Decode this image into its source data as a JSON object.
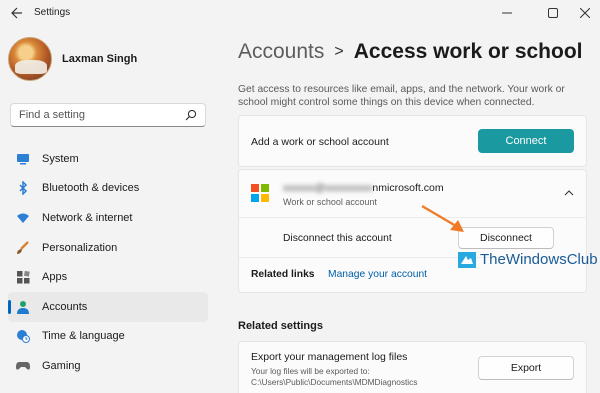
{
  "window": {
    "title": "Settings",
    "controls": [
      "minimize",
      "maximize",
      "close"
    ]
  },
  "profile": {
    "name": "Laxman Singh"
  },
  "search": {
    "placeholder": "Find a setting"
  },
  "nav": {
    "items": [
      {
        "label": "System",
        "icon": "monitor-icon"
      },
      {
        "label": "Bluetooth & devices",
        "icon": "bluetooth-icon"
      },
      {
        "label": "Network & internet",
        "icon": "wifi-icon"
      },
      {
        "label": "Personalization",
        "icon": "brush-icon"
      },
      {
        "label": "Apps",
        "icon": "apps-icon"
      },
      {
        "label": "Accounts",
        "icon": "person-icon",
        "active": true
      },
      {
        "label": "Time & language",
        "icon": "globe-clock-icon"
      },
      {
        "label": "Gaming",
        "icon": "gamepad-icon"
      }
    ]
  },
  "breadcrumb": {
    "parent": "Accounts",
    "separator": ">",
    "current": "Access work or school"
  },
  "description": "Get access to resources like email, apps, and the network. Your work or school might control some things on this device when connected.",
  "add_account": {
    "label": "Add a work or school account",
    "button": "Connect",
    "accent": "#1a9aa0"
  },
  "account": {
    "email_hidden": "xxxxxx@xxxxxxxxx",
    "email_visible": "nmicrosoft.com",
    "type": "Work or school account",
    "disconnect_label": "Disconnect this account",
    "disconnect_button": "Disconnect",
    "related_links_label": "Related links",
    "manage_link": "Manage your account"
  },
  "watermark": "TheWindowsClub",
  "related_settings": {
    "title": "Related settings",
    "export_title": "Export your management log files",
    "export_sub": "Your log files will be exported to: C:\\Users\\Public\\Documents\\MDMDiagnostics",
    "export_button": "Export"
  },
  "colors": {
    "accent_blue": "#0067c0",
    "link": "#005fa8",
    "arrow": "#f07a26"
  }
}
